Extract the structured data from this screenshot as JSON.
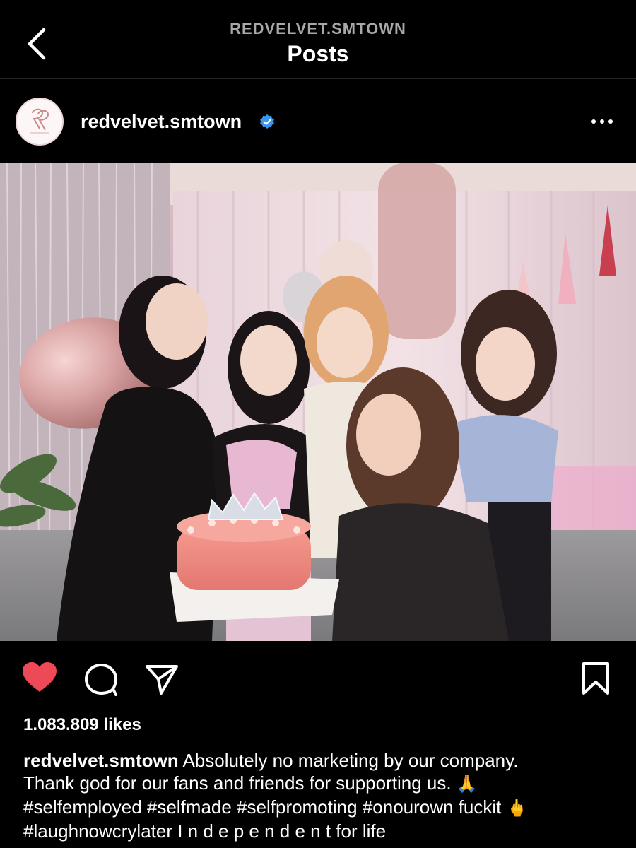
{
  "nav": {
    "account": "REDVELVET.SMTOWN",
    "title": "Posts"
  },
  "post": {
    "username": "redvelvet.smtown",
    "verified": true,
    "likes": "1.083.809 likes",
    "caption": {
      "username": "redvelvet.smtown",
      "line1": "Absolutely no marketing by our company.",
      "line2": "Thank god for our fans and friends for supporting us.",
      "emoji1": "🙏",
      "line3": "#selfemployed #selfmade #selfpromoting #onourown fuckit",
      "emoji2": "🖕",
      "line4": "#laughnowcrylater I n d e p e n d e n t  for life"
    },
    "liked": true
  },
  "icons": {
    "back": "chevron-left-icon",
    "verified": "verified-badge-icon",
    "more": "more-horizontal-icon",
    "like": "heart-icon",
    "comment": "comment-icon",
    "share": "send-icon",
    "save": "bookmark-icon"
  },
  "colors": {
    "background": "#000000",
    "like_red": "#ed4956",
    "verified_blue": "#3897f0",
    "muted_text": "#a8a8a8"
  }
}
